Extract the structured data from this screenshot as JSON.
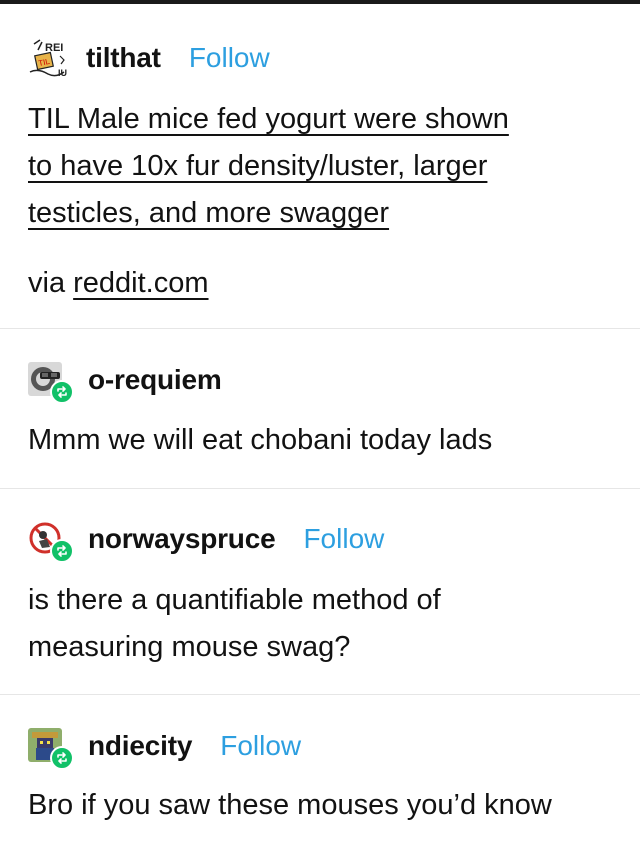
{
  "colors": {
    "follow": "#2d9fe0",
    "reblog_badge": "#11c168",
    "text": "#121212",
    "divider": "#e6e6e6"
  },
  "original_post": {
    "username": "tilthat",
    "follow_label": "Follow",
    "avatar_icon": "til-logo-icon",
    "title_lines": [
      "TIL Male mice fed yogurt were shown",
      "to have 10x fur density/luster, larger",
      "testicles, and more swagger"
    ],
    "via_prefix": "via ",
    "via_link": "reddit.com"
  },
  "reblogs": [
    {
      "username": "o-requiem",
      "follow_label": "",
      "avatar_icon": "sunglasses-avatar-icon",
      "text_lines": [
        "Mmm we will eat chobani today lads"
      ]
    },
    {
      "username": "norwayspruce",
      "follow_label": "Follow",
      "avatar_icon": "no-symbol-avatar-icon",
      "text_lines": [
        "is there a quantifiable method of",
        "measuring mouse swag?"
      ]
    },
    {
      "username": "ndiecity",
      "follow_label": "Follow",
      "avatar_icon": "pixel-wizard-avatar-icon",
      "text_lines": [
        "Bro if you saw these mouses you’d know"
      ]
    }
  ]
}
